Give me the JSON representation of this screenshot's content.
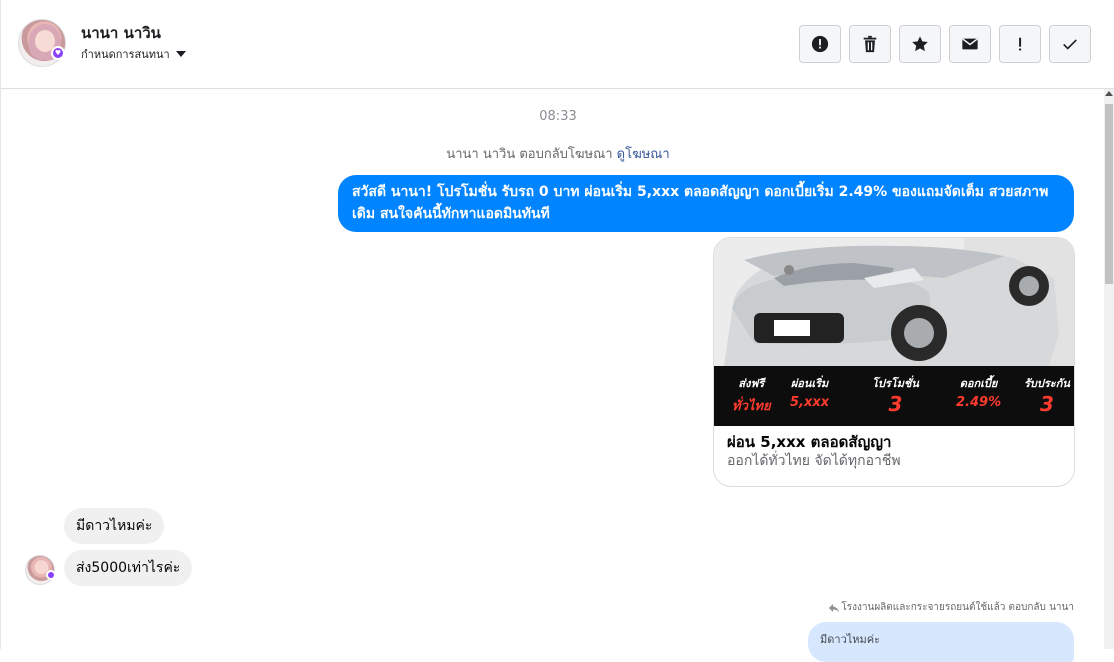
{
  "header": {
    "name": "นานา นาวิน",
    "subtitle": "กำหนดการสนทนา",
    "tools": [
      {
        "icon": "alert-circle-icon"
      },
      {
        "icon": "trash-icon"
      },
      {
        "icon": "star-icon"
      },
      {
        "icon": "envelope-icon"
      },
      {
        "icon": "exclamation-icon"
      },
      {
        "icon": "check-icon"
      }
    ]
  },
  "conversation": {
    "time": "08:33",
    "ad_reply_text": "นานา นาวิน ตอบกลับโฆษณา",
    "ad_reply_link": "ดูโฆษณา",
    "outgoing_message": "สวัสดี นานา! โปรโมชั่น รับรถ 0 บาท ผ่อนเริ่ม 5,xxx ตลอดสัญญา ดอกเบี้ยเริ่ม 2.49% ของแถมจัดเต็ม สวยสภาพเดิม สนใจคันนี้ทักหาแอดมินทันที",
    "ad_card": {
      "banner": [
        {
          "label": "ส่งฟรี",
          "value": "ทั่วไทย"
        },
        {
          "label": "ผ่อนเริ่ม",
          "value": "5,xxx"
        },
        {
          "label": "โปรโมชั่น",
          "value": "3"
        },
        {
          "label": "ดอกเบี้ย",
          "value": "2.49%"
        },
        {
          "label": "รับประกัน",
          "value": "3"
        }
      ],
      "title": "ผ่อน 5,xxx ตลอดสัญญา",
      "subtitle": "ออกได้ทั่วไทย จัดได้ทุกอาชีพ"
    },
    "incoming": [
      {
        "text": "มีดาวไหมค่ะ"
      },
      {
        "text": "ส่ง5000เท่าไรค่ะ"
      }
    ],
    "reply_note": "โรงงานผลิตและกระจายรถยนต์ใช้แล้ว ตอบกลับ นานา",
    "quoted_text": "มีดาวไหมค่ะ"
  },
  "colors": {
    "accent": "#0084ff",
    "incoming_bubble": "#f0f0f0",
    "quoted_bubble": "#d7e7fd",
    "banner_red": "#ff3b2f"
  }
}
